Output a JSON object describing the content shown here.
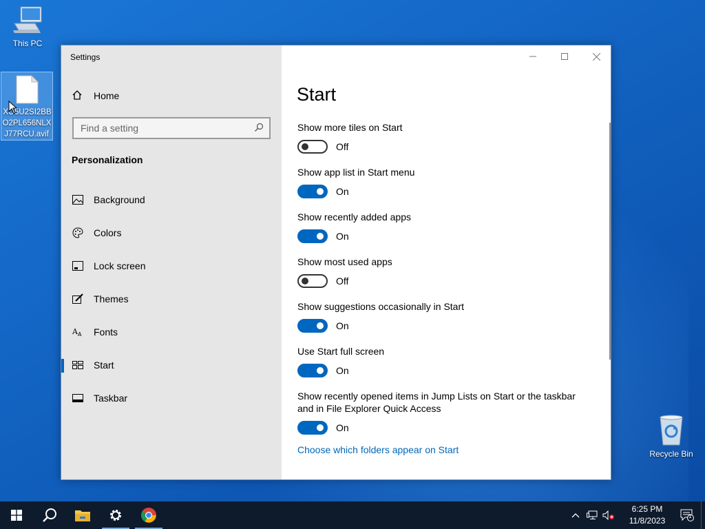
{
  "desktop": {
    "this_pc_label": "This PC",
    "file_label": "XO5U2SI2BBO2PL656NLXJ77RCU.avif",
    "recycle_bin_label": "Recycle Bin"
  },
  "window": {
    "title": "Settings",
    "controls": {
      "minimize": "minimize-icon",
      "maximize": "maximize-icon",
      "close": "close-icon"
    }
  },
  "nav": {
    "home_label": "Home",
    "search_placeholder": "Find a setting",
    "section_title": "Personalization",
    "items": [
      {
        "label": "Background",
        "icon": "picture-icon",
        "selected": false
      },
      {
        "label": "Colors",
        "icon": "palette-icon",
        "selected": false
      },
      {
        "label": "Lock screen",
        "icon": "lock-screen-icon",
        "selected": false
      },
      {
        "label": "Themes",
        "icon": "themes-brush-icon",
        "selected": false
      },
      {
        "label": "Fonts",
        "icon": "fonts-icon",
        "selected": false
      },
      {
        "label": "Start",
        "icon": "start-tiles-icon",
        "selected": true
      },
      {
        "label": "Taskbar",
        "icon": "taskbar-icon",
        "selected": false
      }
    ]
  },
  "page": {
    "title": "Start",
    "settings": [
      {
        "label": "Show more tiles on Start",
        "state": "Off"
      },
      {
        "label": "Show app list in Start menu",
        "state": "On"
      },
      {
        "label": "Show recently added apps",
        "state": "On"
      },
      {
        "label": "Show most used apps",
        "state": "Off"
      },
      {
        "label": "Show suggestions occasionally in Start",
        "state": "On"
      },
      {
        "label": "Use Start full screen",
        "state": "On"
      },
      {
        "label": "Show recently opened items in Jump Lists on Start or the taskbar and in File Explorer Quick Access",
        "state": "On"
      }
    ],
    "link": "Choose which folders appear on Start"
  },
  "taskbar": {
    "apps": [
      "windows-start-icon",
      "search-icon",
      "file-explorer-icon",
      "settings-gear-icon",
      "chrome-icon"
    ],
    "clock_time": "6:25 PM",
    "clock_date": "11/8/2023",
    "notification_count": "1"
  },
  "colors": {
    "accent": "#0067c0",
    "link": "#0067b8",
    "nav_bg": "#e6e6e6",
    "taskbar_bg": "#0e1b2d"
  }
}
